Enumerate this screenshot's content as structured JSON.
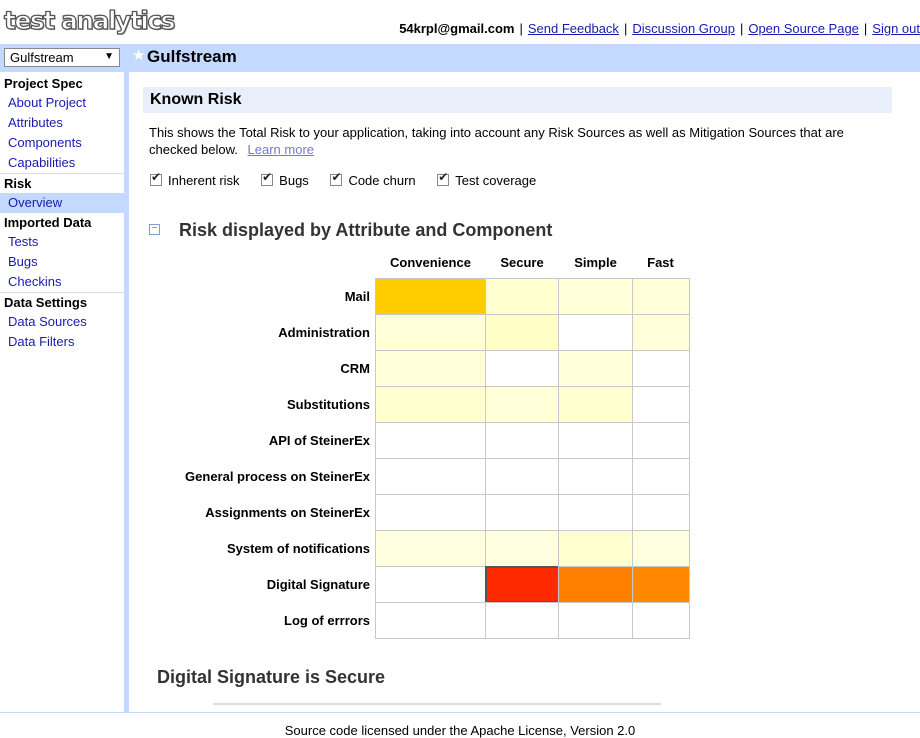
{
  "header": {
    "logo_text": "test analytics",
    "user_email": "54krpl@gmail.com",
    "links": [
      "Send Feedback",
      "Discussion Group",
      "Open Source Page",
      "Sign out"
    ]
  },
  "project": {
    "selected": "Gulfstream",
    "title": "Gulfstream"
  },
  "sidebar": {
    "groups": [
      {
        "title": "Project Spec",
        "items": [
          "About Project",
          "Attributes",
          "Components",
          "Capabilities"
        ]
      },
      {
        "title": "Risk",
        "items": [
          "Overview"
        ]
      },
      {
        "title": "Imported Data",
        "items": [
          "Tests",
          "Bugs",
          "Checkins"
        ]
      },
      {
        "title": "Data Settings",
        "items": [
          "Data Sources",
          "Data Filters"
        ]
      }
    ],
    "active_item": "Overview"
  },
  "main": {
    "heading": "Known Risk",
    "description": "This shows the Total Risk to your application, taking into account any Risk Sources as well as Mitigation Sources that are checked below.",
    "learn_more": "Learn more",
    "checkboxes": [
      {
        "label": "Inherent risk",
        "checked": true
      },
      {
        "label": "Bugs",
        "checked": true
      },
      {
        "label": "Code churn",
        "checked": true
      },
      {
        "label": "Test coverage",
        "checked": true
      }
    ],
    "section_title": "Risk displayed by Attribute and Component",
    "detail_title": "Digital Signature is Secure"
  },
  "grid": {
    "columns": [
      "Convenience",
      "Secure",
      "Simple",
      "Fast"
    ],
    "rows": [
      "Mail",
      "Administration",
      "CRM",
      "Substitutions",
      "API of SteinerEx",
      "General process on SteinerEx",
      "Assignments on SteinerEx",
      "System of notifications",
      "Digital Signature",
      "Log of errrors"
    ],
    "colors": [
      [
        "#ffcc00",
        "#ffffd0",
        "#ffffd8",
        "#ffffd8"
      ],
      [
        "#ffffd8",
        "#ffffc8",
        "#ffffff",
        "#ffffd8"
      ],
      [
        "#ffffd8",
        "#ffffff",
        "#ffffd8",
        "#ffffff"
      ],
      [
        "#ffffd0",
        "#ffffd8",
        "#ffffd0",
        "#ffffff"
      ],
      [
        "#ffffff",
        "#ffffff",
        "#ffffff",
        "#ffffff"
      ],
      [
        "#ffffff",
        "#ffffff",
        "#ffffff",
        "#ffffff"
      ],
      [
        "#ffffff",
        "#ffffff",
        "#ffffff",
        "#ffffff"
      ],
      [
        "#ffffe0",
        "#ffffe0",
        "#ffffd0",
        "#ffffe0"
      ],
      [
        "#ffffff",
        "#ff2a00",
        "#ff8000",
        "#ff8800"
      ],
      [
        "#ffffff",
        "#ffffff",
        "#ffffff",
        "#ffffff"
      ]
    ],
    "selected_cell": {
      "row": "Digital Signature",
      "column": "Secure"
    }
  },
  "footer": {
    "text": "Source code licensed under the Apache License, Version 2.0"
  }
}
